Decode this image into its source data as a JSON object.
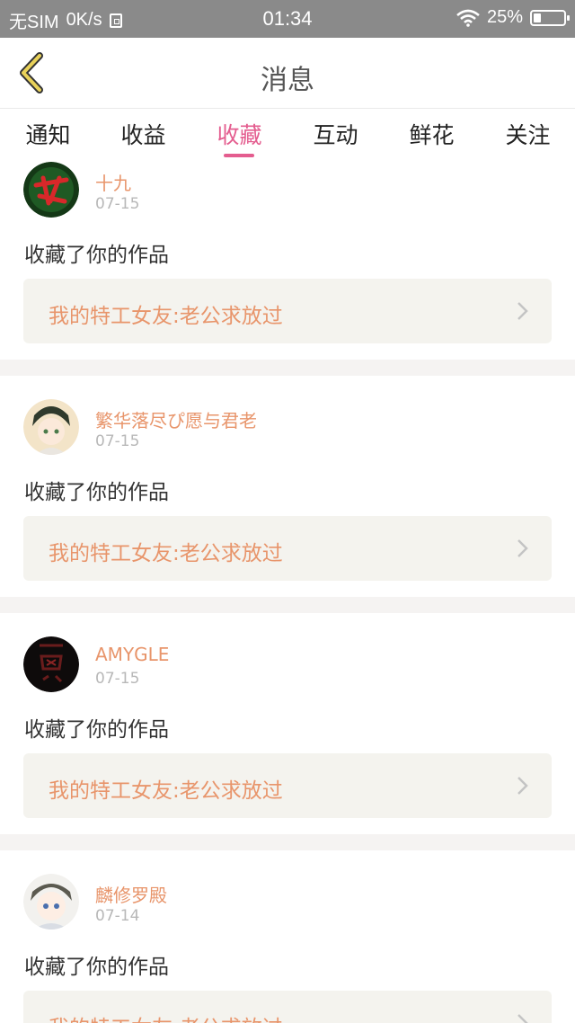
{
  "status_bar": {
    "carrier": "无SIM",
    "speed": "0K/s",
    "time": "01:34",
    "battery": "25%",
    "battery_level": 0.25
  },
  "nav": {
    "title": "消息"
  },
  "tabs": [
    {
      "label": "通知"
    },
    {
      "label": "收益"
    },
    {
      "label": "收藏"
    },
    {
      "label": "互动"
    },
    {
      "label": "鲜花"
    },
    {
      "label": "关注"
    }
  ],
  "active_tab": "收藏",
  "items": [
    {
      "user": "十九",
      "date": "07-15",
      "action": "收藏了你的作品",
      "work": "我的特工女友:老公求放过"
    },
    {
      "user": "繁华落尽ぴ愿与君老",
      "date": "07-15",
      "action": "收藏了你的作品",
      "work": "我的特工女友:老公求放过"
    },
    {
      "user": "AMYGLE",
      "date": "07-15",
      "action": "收藏了你的作品",
      "work": "我的特工女友:老公求放过"
    },
    {
      "user": "麟修罗殿",
      "date": "07-14",
      "action": "收藏了你的作品",
      "work": "我的特工女友:老公求放过"
    }
  ],
  "colors": {
    "accent": "#e45d8f",
    "username": "#e8956b",
    "separator": "#f5f3f2",
    "work_bg": "#f4f3ee"
  }
}
